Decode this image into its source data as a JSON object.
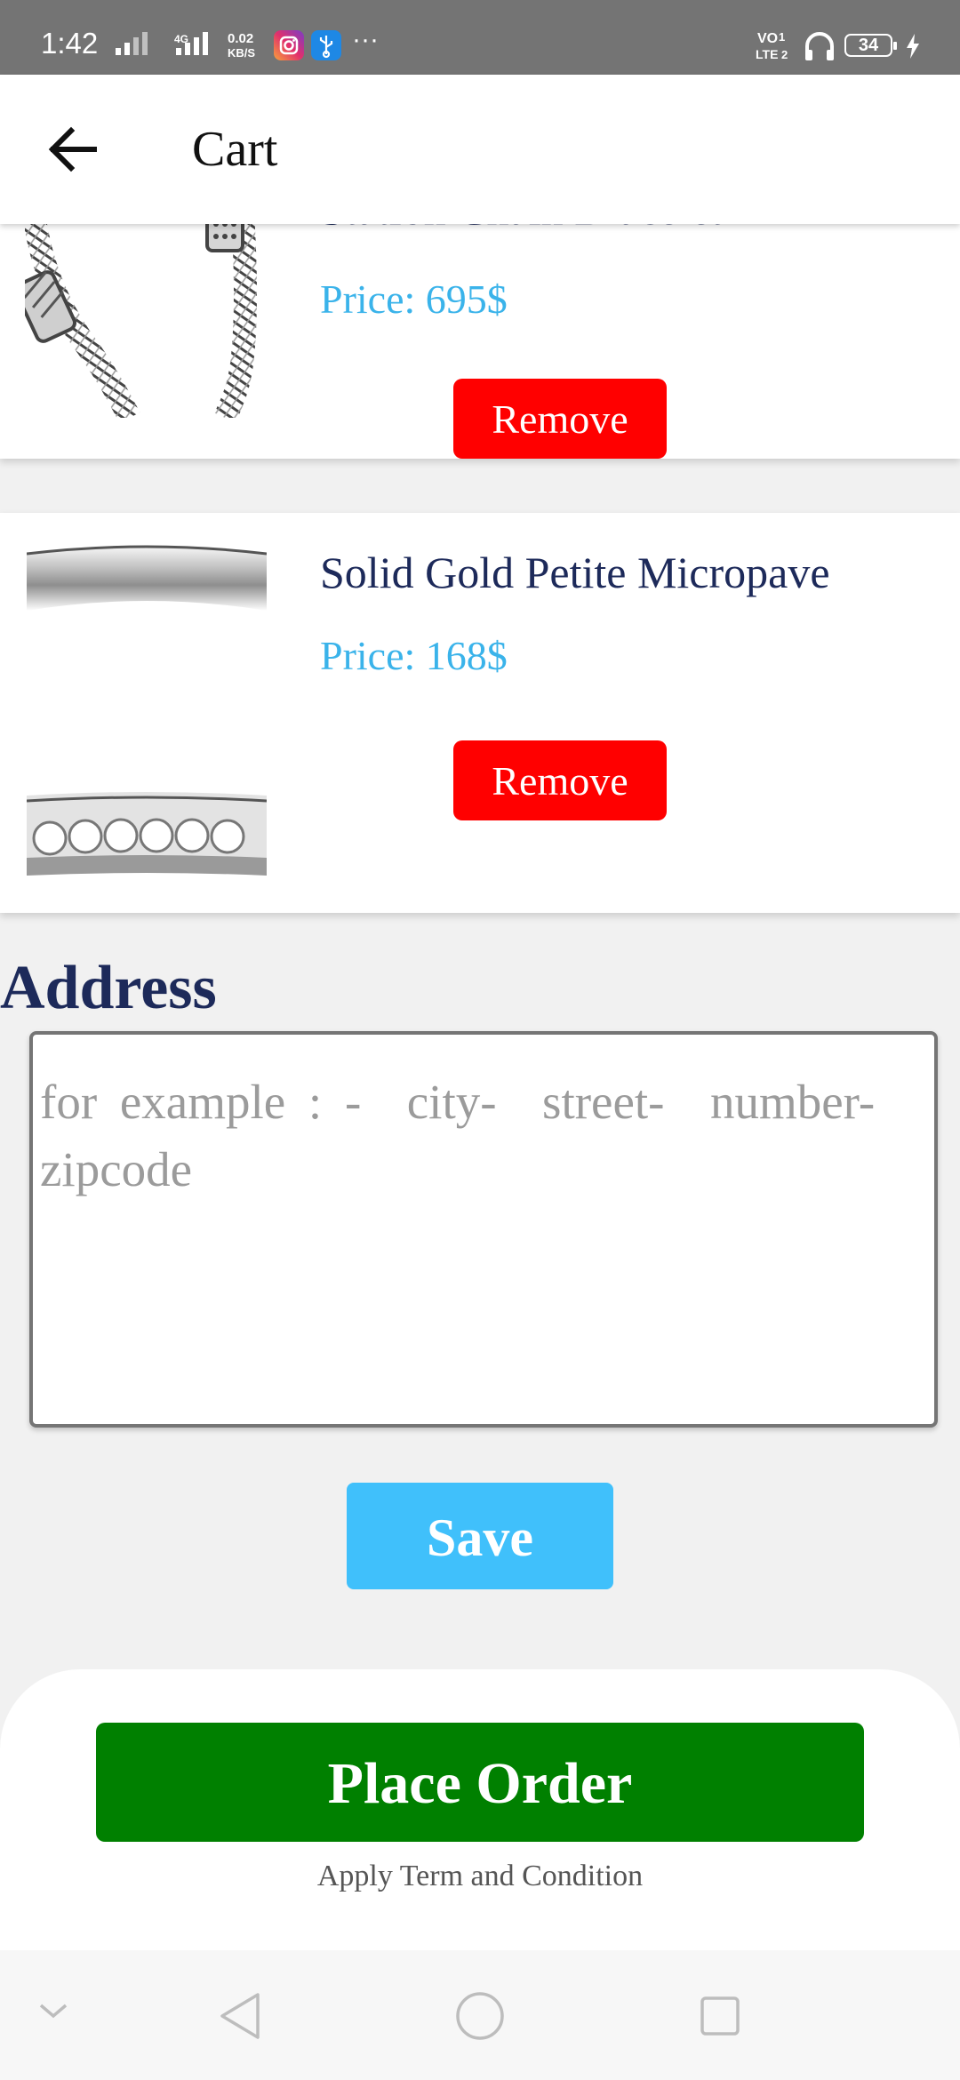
{
  "status_bar": {
    "time": "1:42",
    "network_label": "4G",
    "speed_value": "0.02",
    "speed_unit": "KB/S",
    "more": "···",
    "volte_top": "VO",
    "volte_bottom": "LTE",
    "sim_top": "1",
    "sim_bottom": "2",
    "battery": "34"
  },
  "app_bar": {
    "title": "Cart"
  },
  "cart": {
    "items": [
      {
        "name": "Station Chain Bracelet",
        "price": "Price: 695$",
        "remove_label": "Remove"
      },
      {
        "name": "Solid Gold Petite Micropave",
        "price": "Price: 168$",
        "remove_label": "Remove"
      }
    ]
  },
  "address": {
    "heading": "Address",
    "placeholder": "for example : -  city-  street-  number-zipcode",
    "value": "",
    "save_label": "Save"
  },
  "checkout": {
    "place_order_label": "Place Order",
    "terms_text": "Apply Term and Condition"
  },
  "colors": {
    "remove_button": "#ff0000",
    "save_button": "#40c0fb",
    "place_order_button": "#008000",
    "price_text": "#3ab3ea",
    "title_text": "#1d2a5a"
  }
}
